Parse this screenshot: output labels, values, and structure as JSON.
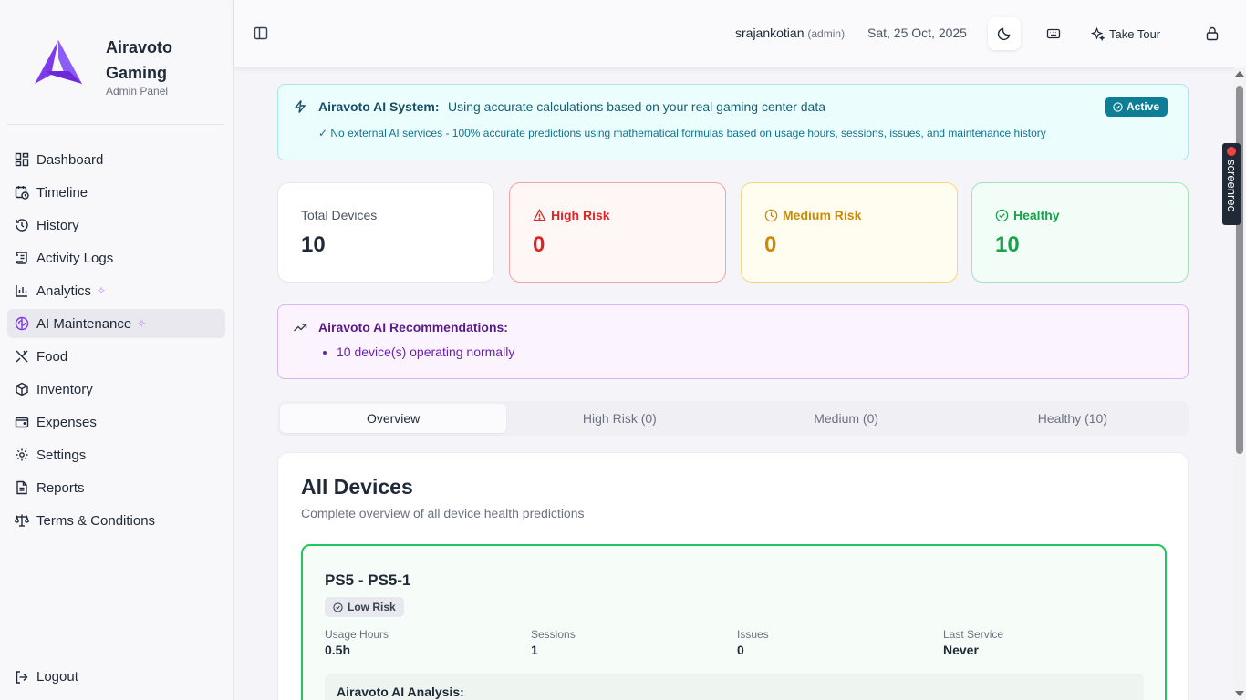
{
  "brand": {
    "name": "Airavoto Gaming",
    "subtitle": "Admin Panel",
    "accent": "#7c3aed"
  },
  "sidebar": {
    "items": [
      {
        "label": "Dashboard",
        "icon": "dashboard-icon"
      },
      {
        "label": "Timeline",
        "icon": "calendar-clock-icon"
      },
      {
        "label": "History",
        "icon": "history-icon"
      },
      {
        "label": "Activity Logs",
        "icon": "scroll-icon"
      },
      {
        "label": "Analytics",
        "icon": "bar-chart-icon",
        "sparkle": true
      },
      {
        "label": "AI Maintenance",
        "icon": "brain-icon",
        "sparkle": true,
        "active": true
      },
      {
        "label": "Food",
        "icon": "utensils-icon"
      },
      {
        "label": "Inventory",
        "icon": "package-icon"
      },
      {
        "label": "Expenses",
        "icon": "wallet-icon"
      },
      {
        "label": "Settings",
        "icon": "gear-icon"
      },
      {
        "label": "Reports",
        "icon": "file-text-icon"
      },
      {
        "label": "Terms & Conditions",
        "icon": "scale-icon"
      }
    ],
    "logout_label": "Logout"
  },
  "header": {
    "username": "srajankotian",
    "role": "(admin)",
    "date": "Sat, 25 Oct, 2025",
    "tour_label": "Take Tour"
  },
  "ai_banner": {
    "title": "Airavoto AI System:",
    "description": "Using accurate calculations based on your real gaming center data",
    "note": "✓ No external AI services - 100% accurate predictions using mathematical formulas based on usage hours, sessions, issues, and maintenance history",
    "badge": "Active"
  },
  "stats": {
    "total": {
      "label": "Total Devices",
      "value": "10"
    },
    "high": {
      "label": "High Risk",
      "value": "0",
      "color": "#dc2626"
    },
    "medium": {
      "label": "Medium Risk",
      "value": "0",
      "color": "#ca8a04"
    },
    "healthy": {
      "label": "Healthy",
      "value": "10",
      "color": "#16a34a"
    }
  },
  "recommendations": {
    "title": "Airavoto AI Recommendations:",
    "items": [
      "10 device(s) operating normally"
    ]
  },
  "tabs": [
    {
      "label": "Overview",
      "active": true
    },
    {
      "label": "High Risk (0)"
    },
    {
      "label": "Medium (0)"
    },
    {
      "label": "Healthy (10)"
    }
  ],
  "devices": {
    "title": "All Devices",
    "subtitle": "Complete overview of all device health predictions",
    "list": [
      {
        "name": "PS5 - PS5-1",
        "risk": "Low Risk",
        "metrics": [
          {
            "label": "Usage Hours",
            "value": "0.5h"
          },
          {
            "label": "Sessions",
            "value": "1"
          },
          {
            "label": "Issues",
            "value": "0"
          },
          {
            "label": "Last Service",
            "value": "Never"
          }
        ],
        "analysis_title": "Airavoto AI Analysis:"
      }
    ]
  },
  "overlay": {
    "recorder_label": "screenrec"
  }
}
